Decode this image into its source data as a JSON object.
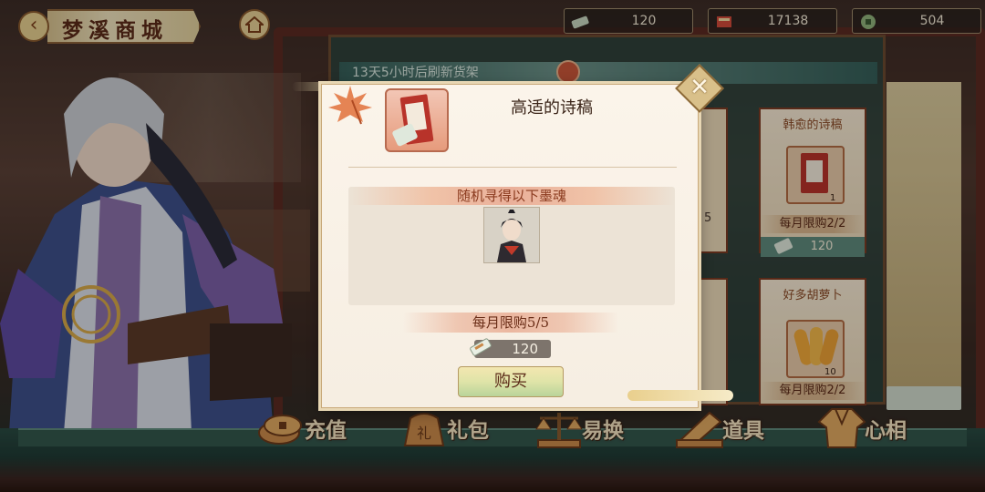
{
  "header": {
    "title": "梦溪商城"
  },
  "currencies": [
    {
      "name": "token",
      "value": "120",
      "color": "#c7d6c0"
    },
    {
      "name": "book",
      "value": "17138",
      "color": "#d04a3a"
    },
    {
      "name": "coin",
      "value": "504",
      "color": "#8fb27a"
    }
  ],
  "shop": {
    "refresh_text": "13天5小时后刷新货架",
    "cards": [
      {
        "title": "韩愈的诗稿",
        "limit": "每月限购2/2",
        "price": "120",
        "badge": "1"
      },
      {
        "title": "好多胡萝卜",
        "limit": "每月限购2/2",
        "badge": "10"
      }
    ],
    "left_card_fragment": "5"
  },
  "popup": {
    "title": "高适的诗稿",
    "section_header": "随机寻得以下墨魂",
    "limit_text": "每月限购5/5",
    "price": "120",
    "buy_label": "购买",
    "close_icon": "close-icon"
  },
  "bottom_nav": [
    {
      "label": "充值",
      "icon": "coins-icon"
    },
    {
      "label": "礼包",
      "icon": "gift-bag-icon",
      "icon_glyph": "礼"
    },
    {
      "label": "易换",
      "icon": "scales-icon"
    },
    {
      "label": "道具",
      "icon": "scroll-icon"
    },
    {
      "label": "心相",
      "icon": "robe-icon"
    }
  ]
}
